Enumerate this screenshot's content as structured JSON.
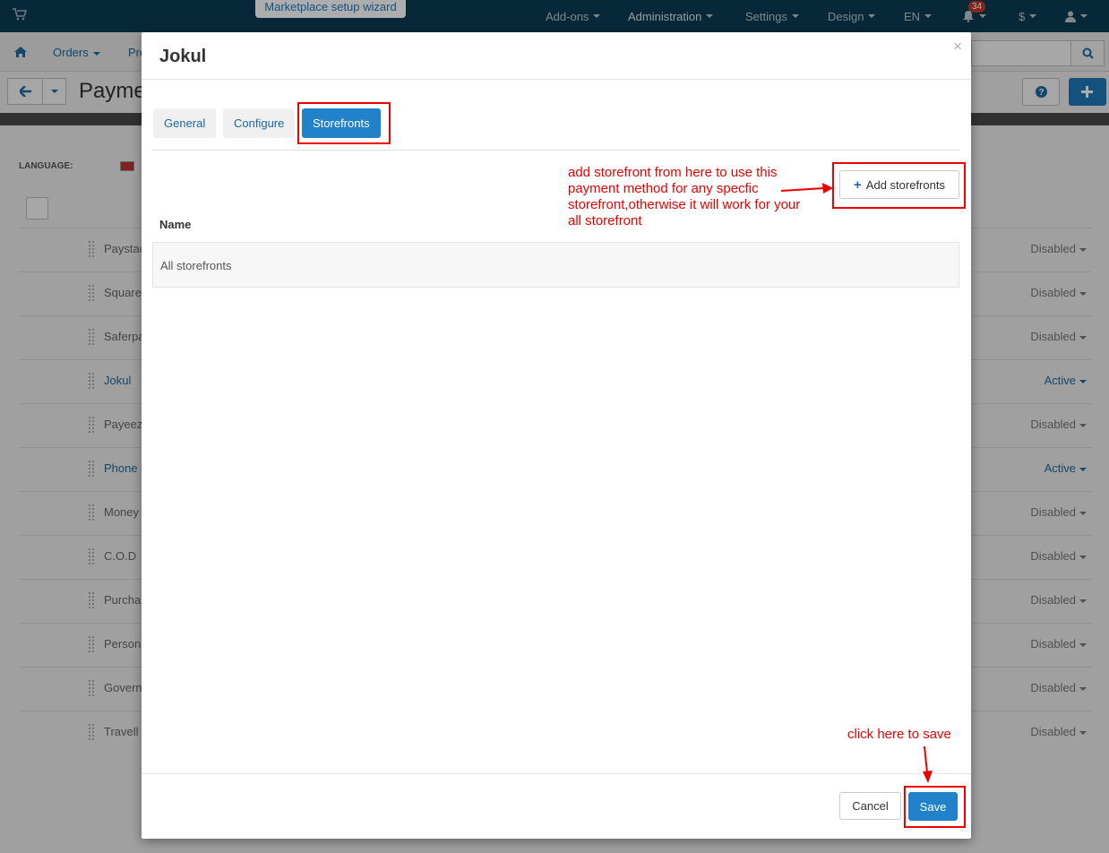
{
  "topbar": {
    "wizard_label": "Marketplace setup wizard",
    "nav": [
      "Add-ons",
      "Administration",
      "Settings",
      "Design",
      "EN"
    ],
    "notification_count": "34",
    "currency": "$"
  },
  "subbar": {
    "orders": "Orders",
    "products_partial": "Pro"
  },
  "background": {
    "page_title_partial": "Payme",
    "language_label": "LANGUAGE:",
    "rows": [
      {
        "name": "Paystac",
        "status": "Disabled",
        "active": false
      },
      {
        "name": "Square",
        "status": "Disabled",
        "active": false
      },
      {
        "name": "Saferpa",
        "status": "Disabled",
        "active": false
      },
      {
        "name": "Jokul",
        "status": "Active",
        "active": true
      },
      {
        "name": "Payeez",
        "status": "Disabled",
        "active": false
      },
      {
        "name": "Phone c",
        "status": "Active",
        "active": true
      },
      {
        "name": "Money",
        "status": "Disabled",
        "active": false
      },
      {
        "name": "C.O.D",
        "status": "Disabled",
        "active": false
      },
      {
        "name": "Purcha",
        "status": "Disabled",
        "active": false
      },
      {
        "name": "Person",
        "status": "Disabled",
        "active": false
      },
      {
        "name": "Govern",
        "status": "Disabled",
        "active": false
      },
      {
        "name": "Travell",
        "status": "Disabled",
        "active": false
      }
    ]
  },
  "modal": {
    "title": "Jokul",
    "close": "×",
    "tabs": [
      "General",
      "Configure",
      "Storefronts"
    ],
    "active_tab": "Storefronts",
    "add_storefronts_label": "Add storefronts",
    "table_header_name": "Name",
    "storefront_rows": [
      "All storefronts"
    ],
    "cancel_label": "Cancel",
    "save_label": "Save"
  },
  "annotations": {
    "storefront_note": "add storefront from here to use this payment method for any specfic storefront,otherwise it will work for your all storefront",
    "save_note": "click here to save"
  },
  "colors": {
    "primary": "#2182c9",
    "annotation_red": "#e00000",
    "navbar": "#0b3c55"
  }
}
